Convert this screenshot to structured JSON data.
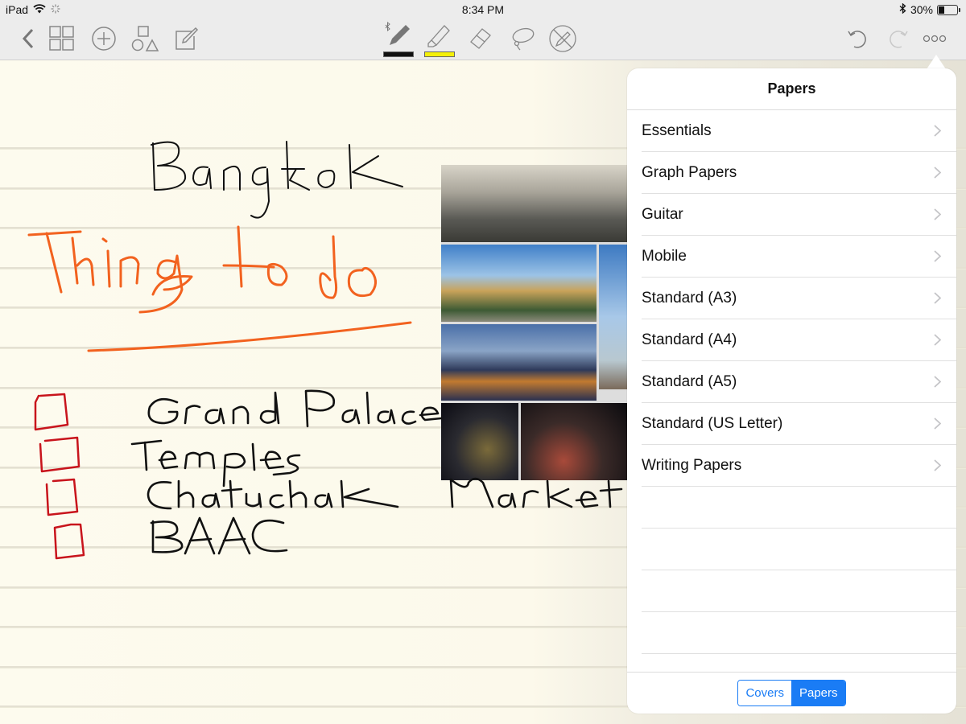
{
  "status_bar": {
    "device": "iPad",
    "time": "8:34 PM",
    "battery_percent_label": "30%",
    "battery_level": 0.3
  },
  "toolbar": {
    "left_icons": [
      "back-chevron-icon",
      "grid-view-icon",
      "add-circle-icon",
      "shapes-icon",
      "edit-square-icon"
    ],
    "tools": [
      {
        "name": "pen-tool",
        "icon": "bluetooth-pen-icon",
        "swatch_color": "#111111"
      },
      {
        "name": "highlighter-tool",
        "icon": "highlighter-icon",
        "swatch_color": "#f4f00a"
      },
      {
        "name": "eraser-tool",
        "icon": "eraser-icon"
      },
      {
        "name": "lasso-tool",
        "icon": "lasso-icon"
      },
      {
        "name": "disable-pen-tool",
        "icon": "pen-disabled-icon"
      }
    ],
    "right_icons": [
      "undo-icon",
      "redo-icon",
      "more-icon"
    ]
  },
  "note": {
    "title": "Bangkok",
    "heading": "Things to do",
    "todo_items": [
      {
        "label": "Grand Palace",
        "checked": false
      },
      {
        "label": "Temples",
        "checked": false
      },
      {
        "label": "Chatuchak Market",
        "checked": false
      },
      {
        "label": "BAAC",
        "checked": false
      }
    ],
    "ink_colors": {
      "black": "#111111",
      "orange": "#f2621f",
      "red": "#c8141c"
    },
    "image": "bangkok-collage"
  },
  "popover": {
    "title": "Papers",
    "items": [
      {
        "label": "Essentials"
      },
      {
        "label": "Graph Papers"
      },
      {
        "label": "Guitar"
      },
      {
        "label": "Mobile"
      },
      {
        "label": "Standard (A3)"
      },
      {
        "label": "Standard (A4)"
      },
      {
        "label": "Standard (A5)"
      },
      {
        "label": "Standard (US Letter)"
      },
      {
        "label": "Writing Papers"
      }
    ],
    "segmented": {
      "options": [
        "Covers",
        "Papers"
      ],
      "selected": "Papers"
    },
    "accent_color": "#1a7cf5"
  }
}
